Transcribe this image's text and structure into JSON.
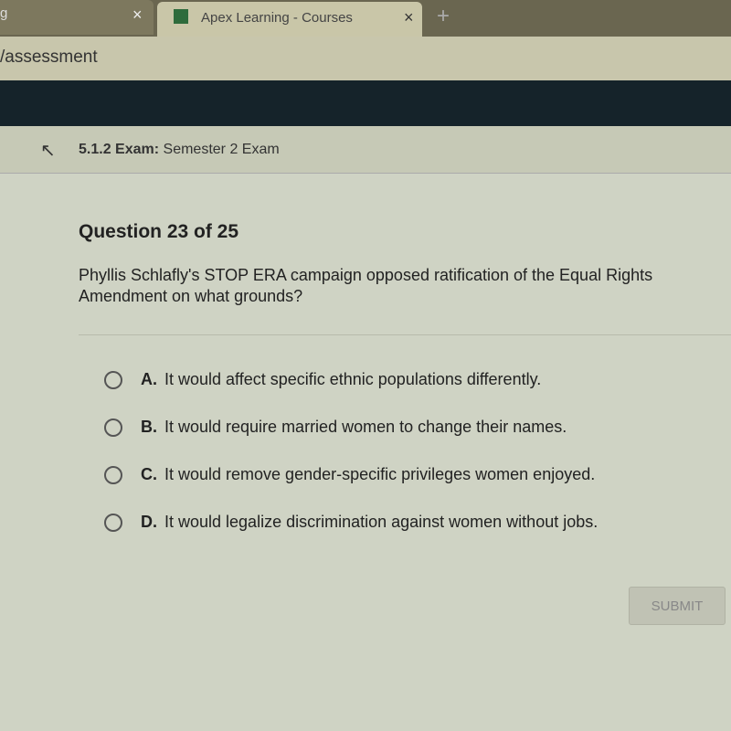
{
  "browser": {
    "tabs": [
      {
        "label": "g",
        "close": "×"
      },
      {
        "label": "Apex Learning - Courses",
        "close": "×"
      }
    ],
    "new_tab": "+",
    "address": "/assessment"
  },
  "breadcrumb": {
    "number": "5.1.2",
    "type": "Exam:",
    "title": "Semester 2 Exam"
  },
  "question": {
    "header": "Question 23 of 25",
    "text": "Phyllis Schlafly's STOP ERA campaign opposed ratification of the Equal Rights Amendment on what grounds?",
    "options": [
      {
        "letter": "A.",
        "text": "It would affect specific ethnic populations differently."
      },
      {
        "letter": "B.",
        "text": "It would require married women to change their names."
      },
      {
        "letter": "C.",
        "text": "It would remove gender-specific privileges women enjoyed."
      },
      {
        "letter": "D.",
        "text": "It would legalize discrimination against women without jobs."
      }
    ]
  },
  "submit_label": "SUBMIT"
}
